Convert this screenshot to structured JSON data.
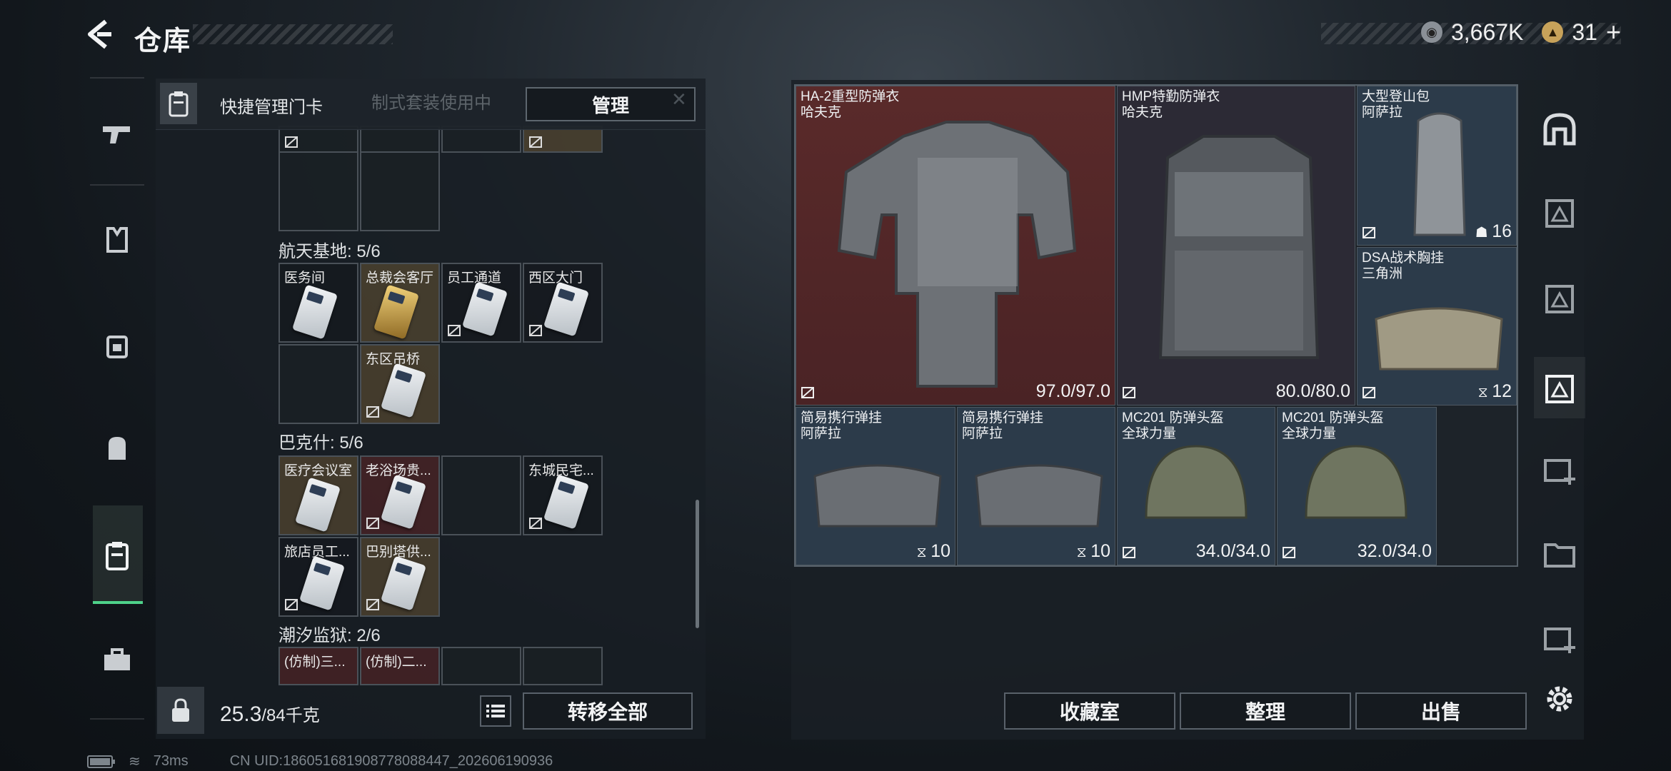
{
  "header": {
    "title": "仓库"
  },
  "currency": {
    "silver": "3,667K",
    "gold": "31",
    "gold_add": "+"
  },
  "key_panel": {
    "title": "快捷管理门卡",
    "suit_note": "制式套装使用中",
    "manage_label": "管理",
    "sections": [
      {
        "title": "航天基地: 5/6",
        "cards": [
          "医务间",
          "总裁会客厅",
          "员工通道",
          "西区大门",
          "东区吊桥"
        ]
      },
      {
        "title": "巴克什: 5/6",
        "cards": [
          "医疗会议室",
          "老浴场贵...",
          "东城民宅...",
          "旅店员工...",
          "巴别塔供..."
        ]
      },
      {
        "title": "潮汐监狱: 2/6",
        "cards": [
          "(仿制)三...",
          "(仿制)二..."
        ]
      }
    ]
  },
  "weight": {
    "value": "25.3",
    "capacity": "/84千克"
  },
  "buttons": {
    "transfer_all": "转移全部",
    "collection": "收藏室",
    "organize": "整理",
    "sell": "出售"
  },
  "items": [
    {
      "name": "HA-2重型防弹衣",
      "brand": "哈夫克",
      "value": "97.0/97.0"
    },
    {
      "name": "HMP特勤防弹衣",
      "brand": "哈夫克",
      "value": "80.0/80.0"
    },
    {
      "name": "大型登山包",
      "brand": "阿萨拉",
      "value": "16"
    },
    {
      "name": "DSA战术胸挂",
      "brand": "三角洲",
      "value": "12"
    },
    {
      "name": "简易携行弹挂",
      "brand": "阿萨拉",
      "value": "10"
    },
    {
      "name": "简易携行弹挂",
      "brand": "阿萨拉",
      "value": "10"
    },
    {
      "name": "MC201 防弹头盔",
      "brand": "全球力量",
      "value": "34.0/34.0"
    },
    {
      "name": "MC201 防弹头盔",
      "brand": "全球力量",
      "value": "32.0/34.0"
    }
  ],
  "status": {
    "ping": "73ms",
    "uid": "CN UID:186051681908778088447_202606190936"
  },
  "colors": {
    "accent_green": "#4ed28a",
    "red_slot": "#5a2a2a",
    "blue_slot": "#2c3b4a"
  },
  "icons": {
    "left_nav": [
      "gun-icon",
      "vest-icon",
      "chest-rig-icon",
      "backpack-icon",
      "keycard-icon",
      "toolbox-icon"
    ],
    "right_nav": [
      "safe-icon",
      "container-3-icon",
      "container-3b-icon",
      "container-3-active-icon",
      "container-2-add-icon",
      "container-4-icon",
      "container-4-add-icon",
      "settings-icon"
    ]
  }
}
